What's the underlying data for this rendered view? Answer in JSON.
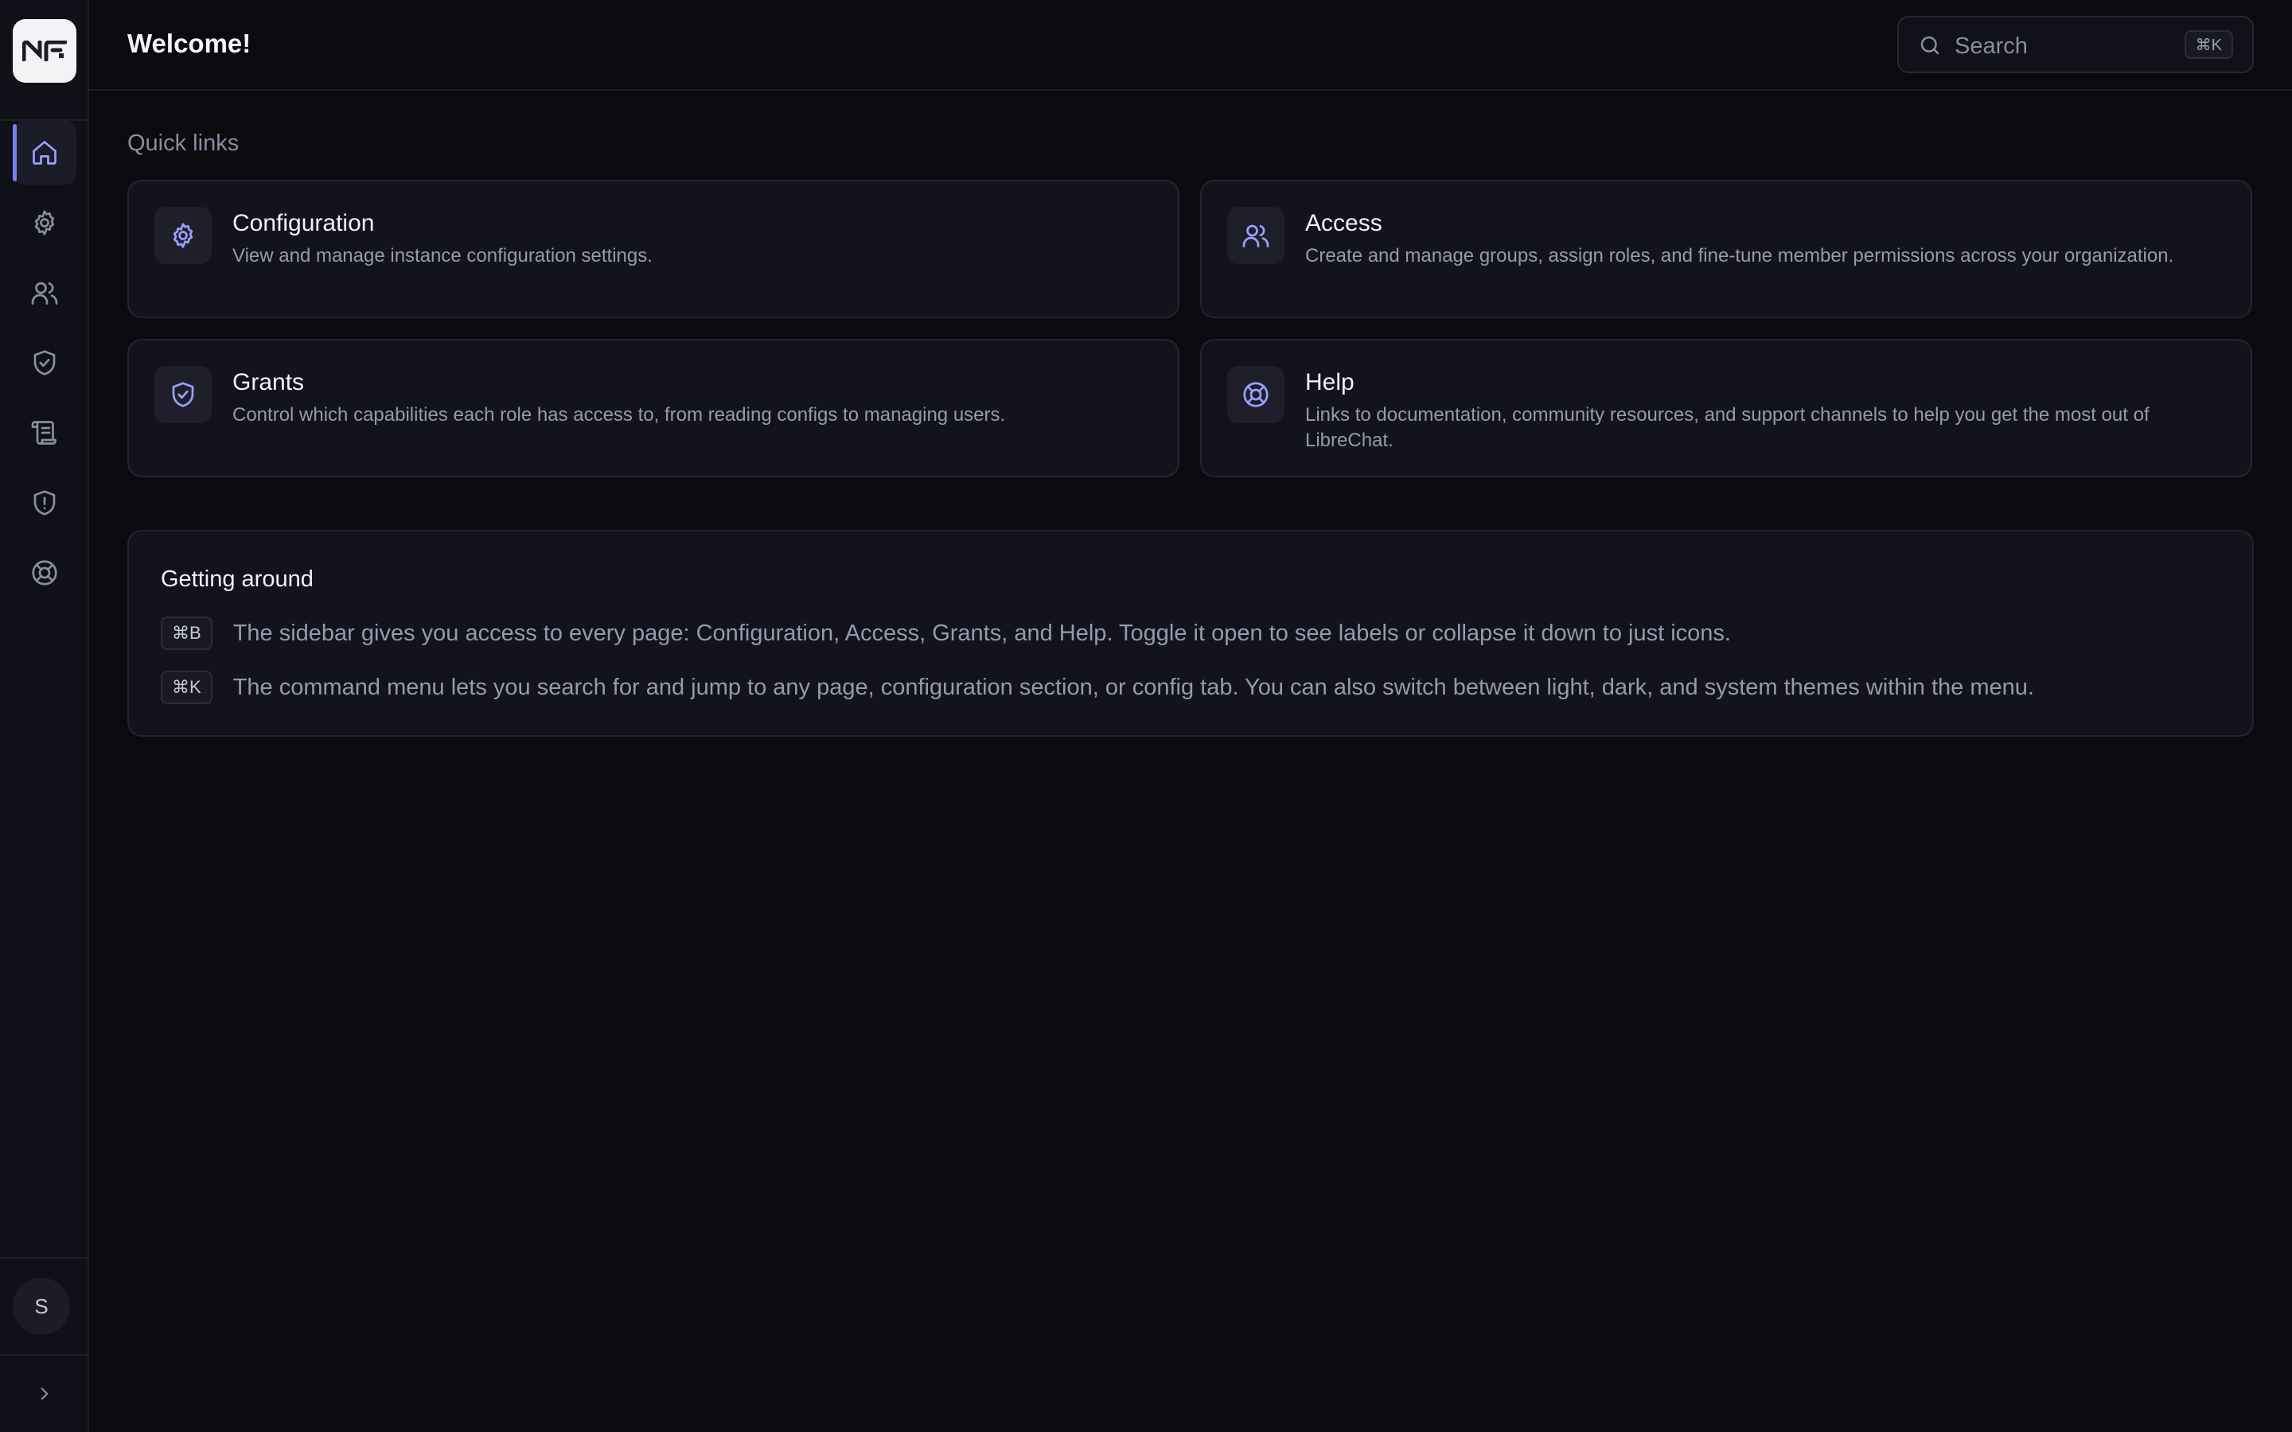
{
  "header": {
    "title": "Welcome!",
    "search_placeholder": "Search",
    "search_shortcut": "⌘K"
  },
  "sidebar": {
    "items": [
      {
        "name": "home",
        "icon": "home-icon",
        "active": true
      },
      {
        "name": "configuration",
        "icon": "gear-icon",
        "active": false
      },
      {
        "name": "access",
        "icon": "users-icon",
        "active": false
      },
      {
        "name": "grants",
        "icon": "shield-check-icon",
        "active": false
      },
      {
        "name": "logs",
        "icon": "scroll-icon",
        "active": false
      },
      {
        "name": "security",
        "icon": "shield-alert-icon",
        "active": false
      },
      {
        "name": "help",
        "icon": "lifebuoy-icon",
        "active": false
      }
    ],
    "avatar_initial": "S"
  },
  "quick_links": {
    "label": "Quick links",
    "cards": [
      {
        "title": "Configuration",
        "description": "View and manage instance configuration settings.",
        "icon": "gear-icon"
      },
      {
        "title": "Access",
        "description": "Create and manage groups, assign roles, and fine-tune member permissions across your organization.",
        "icon": "users-icon"
      },
      {
        "title": "Grants",
        "description": "Control which capabilities each role has access to, from reading configs to managing users.",
        "icon": "shield-check-icon"
      },
      {
        "title": "Help",
        "description": "Links to documentation, community resources, and support channels to help you get the most out of LibreChat.",
        "icon": "lifebuoy-icon"
      }
    ]
  },
  "getting_around": {
    "title": "Getting around",
    "rows": [
      {
        "shortcut": "⌘B",
        "text": "The sidebar gives you access to every page: Configuration, Access, Grants, and Help. Toggle it open to see labels or collapse it down to just icons."
      },
      {
        "shortcut": "⌘K",
        "text": "The command menu lets you search for and jump to any page, configuration section, or config tab. You can also switch between light, dark, and system themes within the menu."
      }
    ]
  },
  "colors": {
    "background": "#0a0a0f",
    "accent": "#7b80f0",
    "card": "#12131c"
  }
}
